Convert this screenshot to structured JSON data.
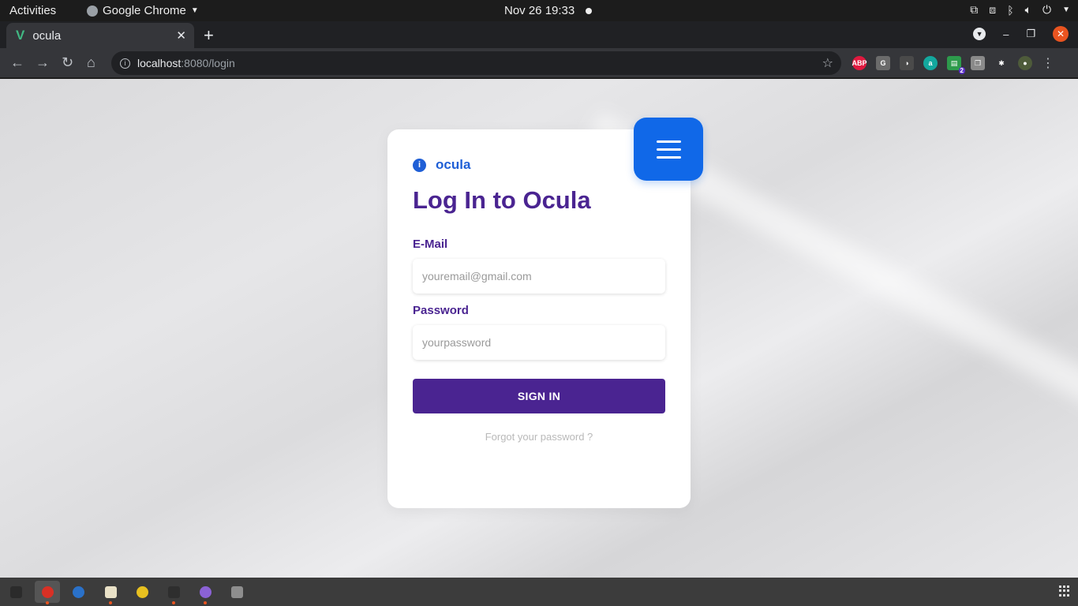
{
  "system_bar": {
    "activities": "Activities",
    "app_name": "Google Chrome",
    "clock": "Nov 26  19:33"
  },
  "browser": {
    "tab_title": "ocula",
    "url_host": "localhost",
    "url_path": ":8080/login",
    "extensions": [
      {
        "name": "adblock-plus-icon",
        "text": "ABP",
        "color": "#e0193f"
      },
      {
        "name": "grammar-extension-icon",
        "text": "G",
        "color": "#6b6b6b"
      },
      {
        "name": "clipper-extension-icon",
        "text": "◑",
        "color": "#4a4a4a"
      },
      {
        "name": "amazon-assistant-icon",
        "text": "a",
        "color": "#13a89e"
      },
      {
        "name": "colorful-tabs-icon",
        "text": "▤",
        "color": "#2d9b4c",
        "badge": "2"
      },
      {
        "name": "grey-extension-icon",
        "text": "❒",
        "color": "#8a8a8a"
      },
      {
        "name": "extensions-puzzle-icon",
        "text": "✱",
        "color": "#35363a"
      },
      {
        "name": "profile-avatar-icon",
        "text": "●",
        "color": "#4e5b3a"
      }
    ]
  },
  "login": {
    "brand": "ocula",
    "heading": "Log In to Ocula",
    "email_label": "E-Mail",
    "email_placeholder": "youremail@gmail.com",
    "password_label": "Password",
    "password_placeholder": "yourpassword",
    "submit_label": "SIGN IN",
    "forgot_label": "Forgot your password ?"
  },
  "colors": {
    "primary": "#4a2491",
    "accent_blue": "#1068e8"
  },
  "dock": [
    {
      "name": "terminal-app-icon",
      "color": "#2b2b2b",
      "active": false,
      "running": false
    },
    {
      "name": "chrome-app-icon",
      "color": "#d93025",
      "active": true,
      "running": true
    },
    {
      "name": "thunderbird-app-icon",
      "color": "#2a71c9",
      "active": false,
      "running": false
    },
    {
      "name": "files-app-icon",
      "color": "#e9e1c7",
      "active": false,
      "running": true
    },
    {
      "name": "rhythmbox-app-icon",
      "color": "#e8c120",
      "active": false,
      "running": false
    },
    {
      "name": "console-app-icon",
      "color": "#2e2e2e",
      "active": false,
      "running": true
    },
    {
      "name": "purple-app-icon",
      "color": "#8b62d6",
      "active": false,
      "running": true
    },
    {
      "name": "disk-app-icon",
      "color": "#8e8e8e",
      "active": false,
      "running": false
    }
  ]
}
